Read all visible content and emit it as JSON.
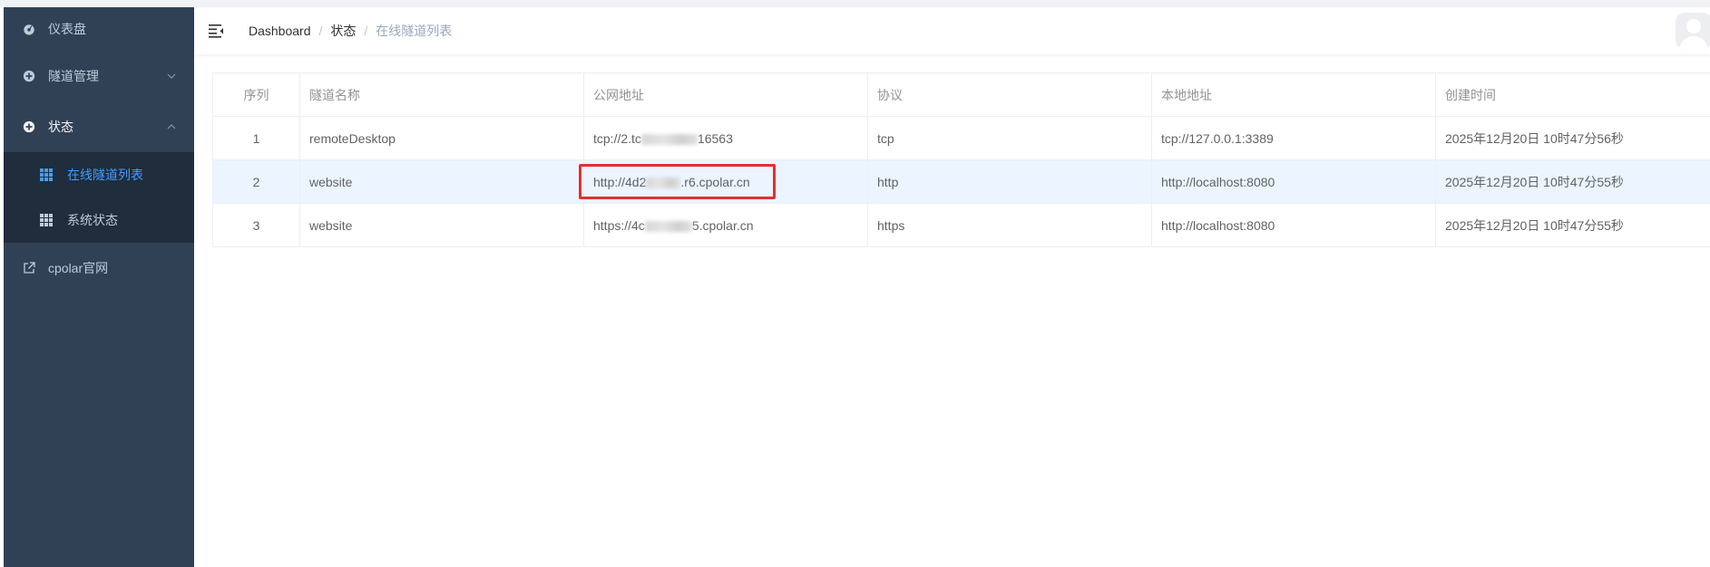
{
  "sidebar": {
    "dashboard": "仪表盘",
    "tunnel_mgmt": "隧道管理",
    "status": "状态",
    "online_tunnels": "在线隧道列表",
    "system_status": "系统状态",
    "cpolar_site": "cpolar官网"
  },
  "breadcrumb": {
    "home": "Dashboard",
    "separator": "/",
    "parent": "状态",
    "current": "在线隧道列表"
  },
  "table": {
    "headers": [
      "序列",
      "隧道名称",
      "公网地址",
      "协议",
      "本地地址",
      "创建时间"
    ],
    "rows": [
      {
        "index": "1",
        "name": "remoteDesktop",
        "url_prefix": "tcp://2.tc",
        "url_suffix": "16563",
        "protocol": "tcp",
        "local": "tcp://127.0.0.1:3389",
        "created": "2025年12月20日 10时47分56秒"
      },
      {
        "index": "2",
        "name": "website",
        "url_prefix": "http://4d2",
        "url_suffix": ".r6.cpolar.cn",
        "protocol": "http",
        "local": "http://localhost:8080",
        "created": "2025年12月20日 10时47分55秒"
      },
      {
        "index": "3",
        "name": "website",
        "url_prefix": "https://4c",
        "url_suffix": "5.cpolar.cn",
        "protocol": "https",
        "local": "http://localhost:8080",
        "created": "2025年12月20日 10时47分55秒"
      }
    ]
  },
  "colors": {
    "sidebar_bg": "#304156",
    "submenu_bg": "#1f2d3d",
    "active_link": "#409eff",
    "highlight_row": "#ecf5ff",
    "annotation_red": "#e03131"
  }
}
